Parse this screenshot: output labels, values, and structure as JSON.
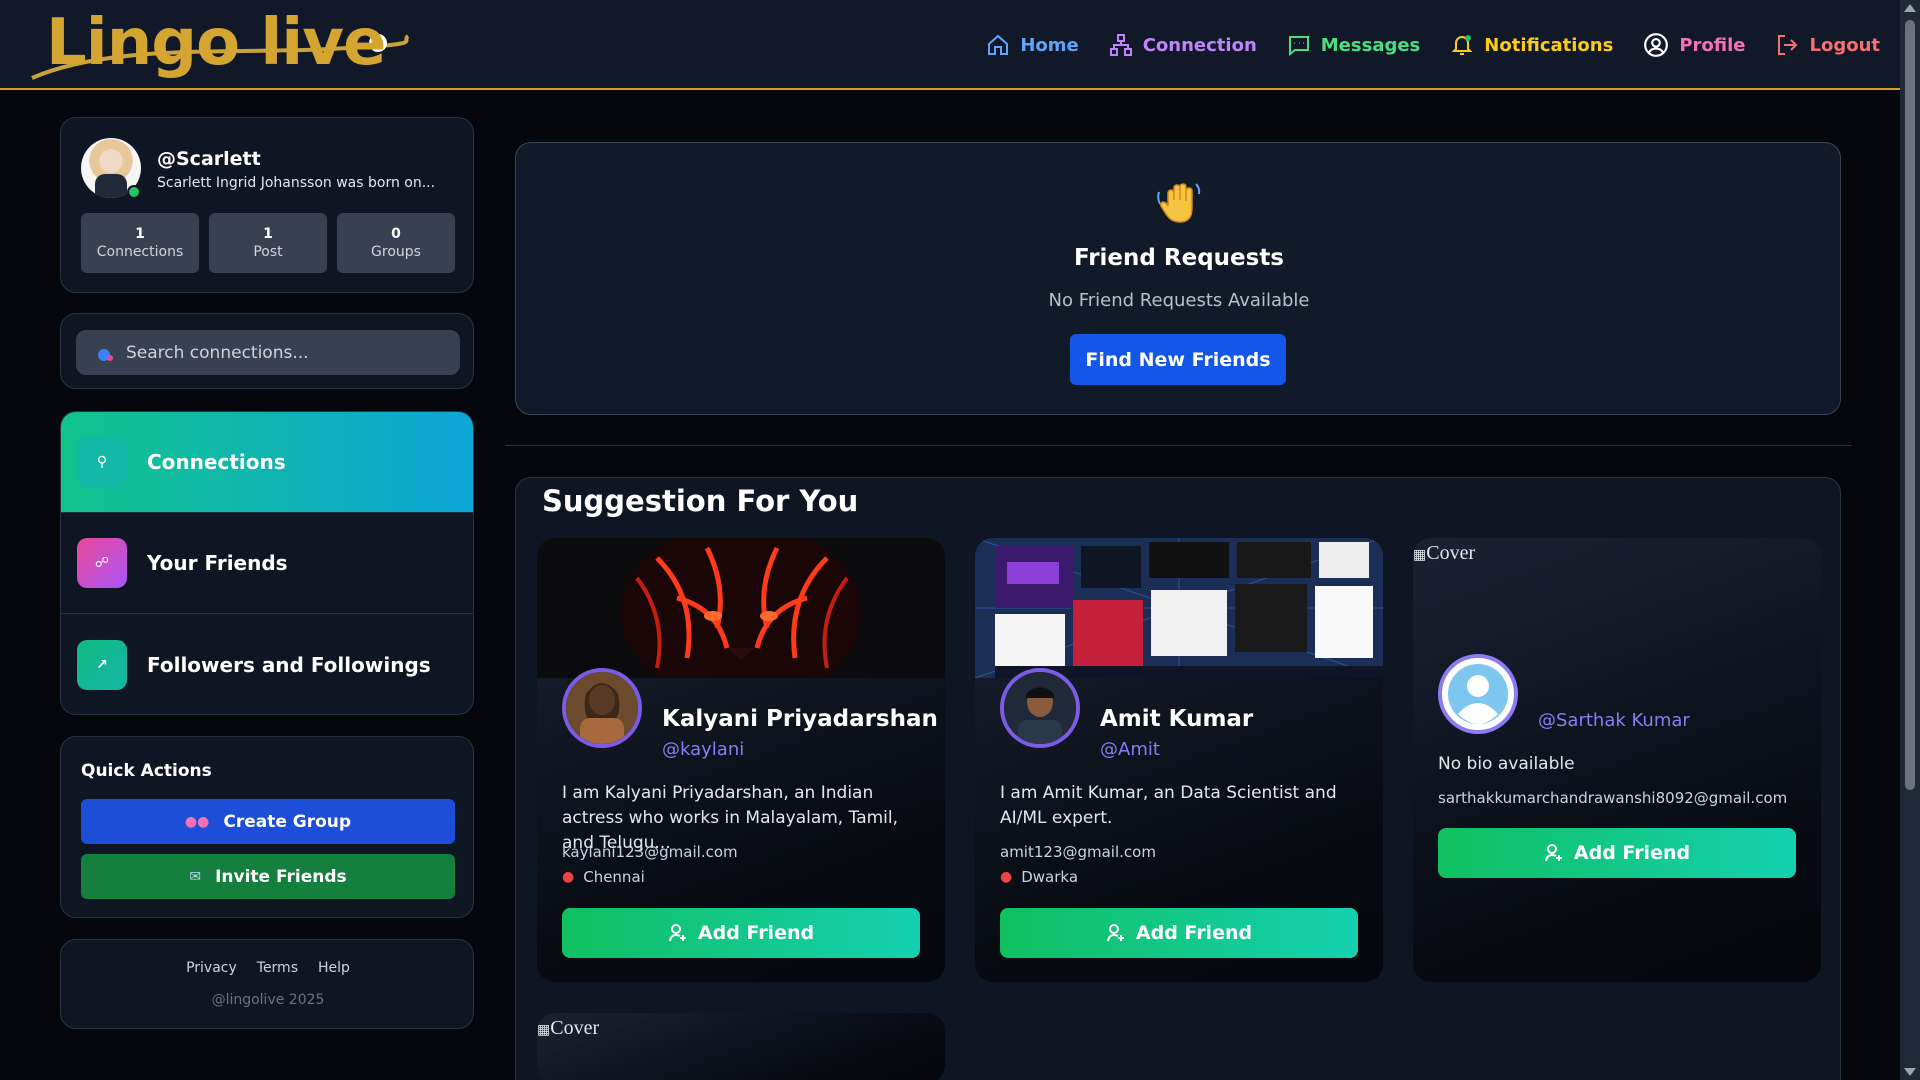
{
  "navbar": {
    "logo_text": "Lingo live",
    "links": [
      {
        "label": "Home",
        "icon": "home-icon",
        "color": "#60a5fa"
      },
      {
        "label": "Connection",
        "icon": "network-icon",
        "color": "#c084fc"
      },
      {
        "label": "Messages",
        "icon": "message-icon",
        "color": "#4ade80"
      },
      {
        "label": "Notifications",
        "icon": "bell-icon",
        "color": "#facc15"
      },
      {
        "label": "Profile",
        "icon": "user-circle-icon",
        "color": "#f472b6"
      },
      {
        "label": "Logout",
        "icon": "logout-icon",
        "color": "#f87171"
      }
    ]
  },
  "sidebar": {
    "profile": {
      "username": "@Scarlett",
      "bio": "Scarlett Ingrid Johansson was born on...",
      "stats": [
        {
          "value": "1",
          "label": "Connections"
        },
        {
          "value": "1",
          "label": "Post"
        },
        {
          "value": "0",
          "label": "Groups"
        }
      ]
    },
    "search": {
      "placeholder": "Search connections..."
    },
    "menu": [
      {
        "label": "Connections",
        "icon": "user-icon",
        "icon_bg": "#14b8a6",
        "active": true
      },
      {
        "label": "Your Friends",
        "icon": "link-icon",
        "icon_bg": "#d946ef",
        "active": false
      },
      {
        "label": "Followers and Followings",
        "icon": "arrow-up-right-icon",
        "icon_bg": "#10b981",
        "active": false
      }
    ],
    "quick_actions": {
      "title": "Quick Actions",
      "create_group": "Create Group",
      "invite_friends": "Invite Friends"
    },
    "footer": {
      "links": [
        "Privacy",
        "Terms",
        "Help"
      ],
      "copyright": "@lingolive 2025"
    }
  },
  "friend_requests": {
    "icon": "waving-hand-icon",
    "title": "Friend Requests",
    "subtitle": "No Friend Requests Available",
    "button": "Find New Friends"
  },
  "suggestions": {
    "title": "Suggestion For You",
    "cards": [
      {
        "name": "Kalyani Priyadarshan",
        "handle": "@kaylani",
        "bio": "I am Kalyani Priyadarshan, an Indian actress who works in Malayalam, Tamil, and Telugu...",
        "email": "kaylani123@gmail.com",
        "location": "Chennai",
        "button": "Add Friend"
      },
      {
        "name": "Amit Kumar",
        "handle": "@Amit",
        "bio": "I am Amit Kumar, an Data Scientist and AI/ML expert.",
        "email": "amit123@gmail.com",
        "location": "Dwarka",
        "button": "Add Friend"
      },
      {
        "cover_alt": "Cover",
        "handle": "@Sarthak Kumar",
        "bio": "No bio available",
        "email": "sarthakkumarchandrawanshi8092@gmail.com",
        "button": "Add Friend"
      },
      {
        "cover_alt": "Cover"
      }
    ]
  }
}
